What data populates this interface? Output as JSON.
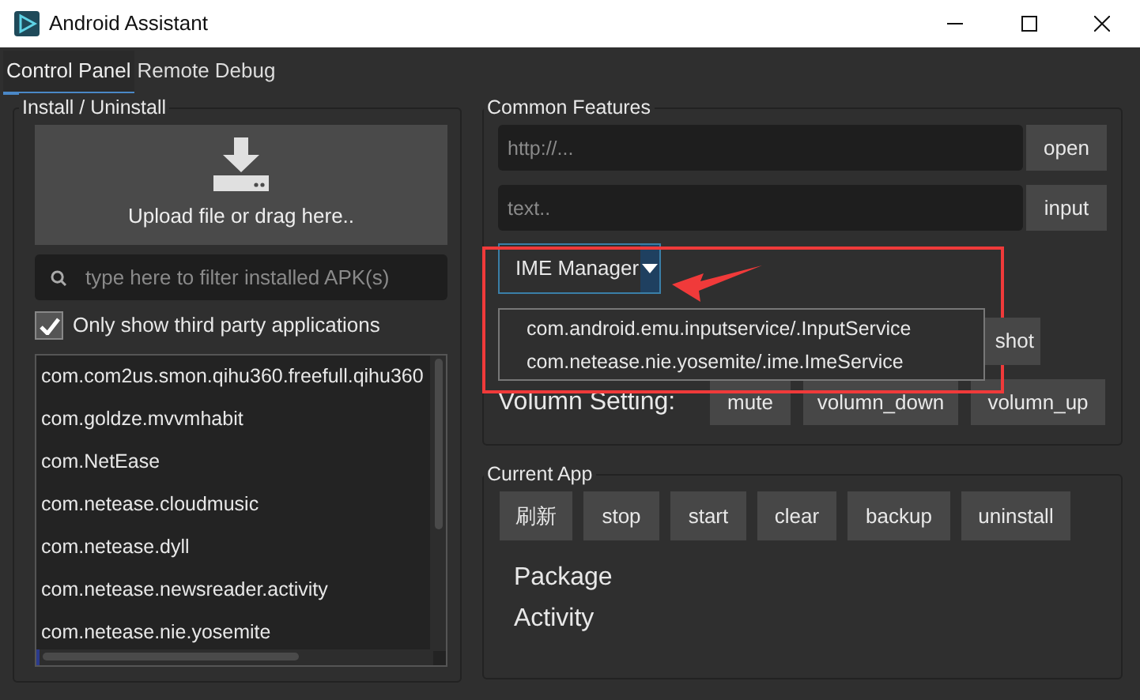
{
  "window": {
    "title": "Android Assistant"
  },
  "tabs": [
    {
      "label": "Control Panel",
      "selected": true
    },
    {
      "label": "Remote Debug",
      "selected": false
    }
  ],
  "install_panel": {
    "title": "Install / Uninstall",
    "upload_label": "Upload file or drag here..",
    "filter": {
      "placeholder": "type here to filter installed APK(s)"
    },
    "third_party_only": {
      "label": "Only show third party applications",
      "checked": true
    },
    "packages": [
      "com.com2us.smon.qihu360.freefull.qihu360",
      "com.goldze.mvvmhabit",
      "com.NetEase",
      "com.netease.cloudmusic",
      "com.netease.dyll",
      "com.netease.newsreader.activity",
      "com.netease.nie.yosemite"
    ]
  },
  "common_features": {
    "title": "Common Features",
    "url_field": {
      "placeholder": "http://..."
    },
    "open_button": "open",
    "text_field": {
      "placeholder": "text.."
    },
    "input_button": "input",
    "ime_dropdown": {
      "label": "IME Manager",
      "expanded": true,
      "options": [
        "com.android.emu.inputservice/.InputService",
        "com.netease.nie.yosemite/.ime.ImeService"
      ]
    },
    "hidden_button": "shot",
    "volume": {
      "label": "Volumn Setting:",
      "buttons": [
        "mute",
        "volumn_down",
        "volumn_up"
      ]
    }
  },
  "current_app": {
    "title": "Current App",
    "buttons": [
      "刷新",
      "stop",
      "start",
      "clear",
      "backup",
      "uninstall"
    ],
    "fields": [
      "Package",
      "Activity"
    ]
  }
}
